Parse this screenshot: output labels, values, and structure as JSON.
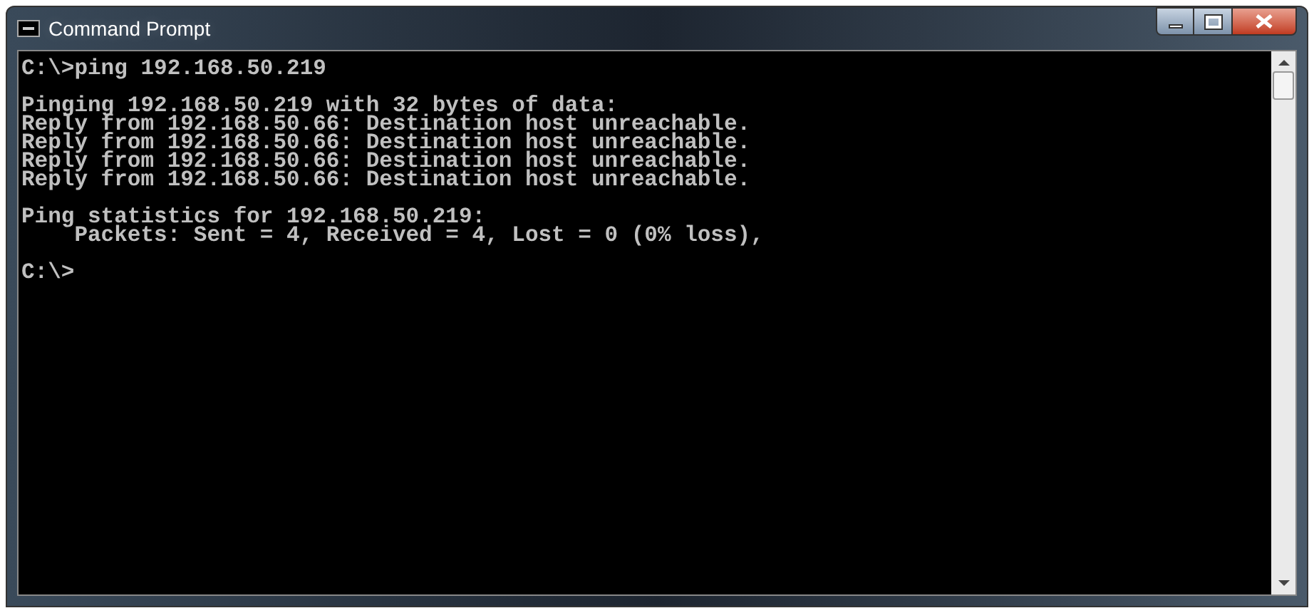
{
  "window": {
    "title": "Command Prompt"
  },
  "console": {
    "blocks": [
      [
        "C:\\>ping 192.168.50.219"
      ],
      [
        "Pinging 192.168.50.219 with 32 bytes of data:",
        "Reply from 192.168.50.66: Destination host unreachable.",
        "Reply from 192.168.50.66: Destination host unreachable.",
        "Reply from 192.168.50.66: Destination host unreachable.",
        "Reply from 192.168.50.66: Destination host unreachable."
      ],
      [
        "Ping statistics for 192.168.50.219:",
        "    Packets: Sent = 4, Received = 4, Lost = 0 (0% loss),"
      ],
      [
        "C:\\>"
      ]
    ]
  }
}
